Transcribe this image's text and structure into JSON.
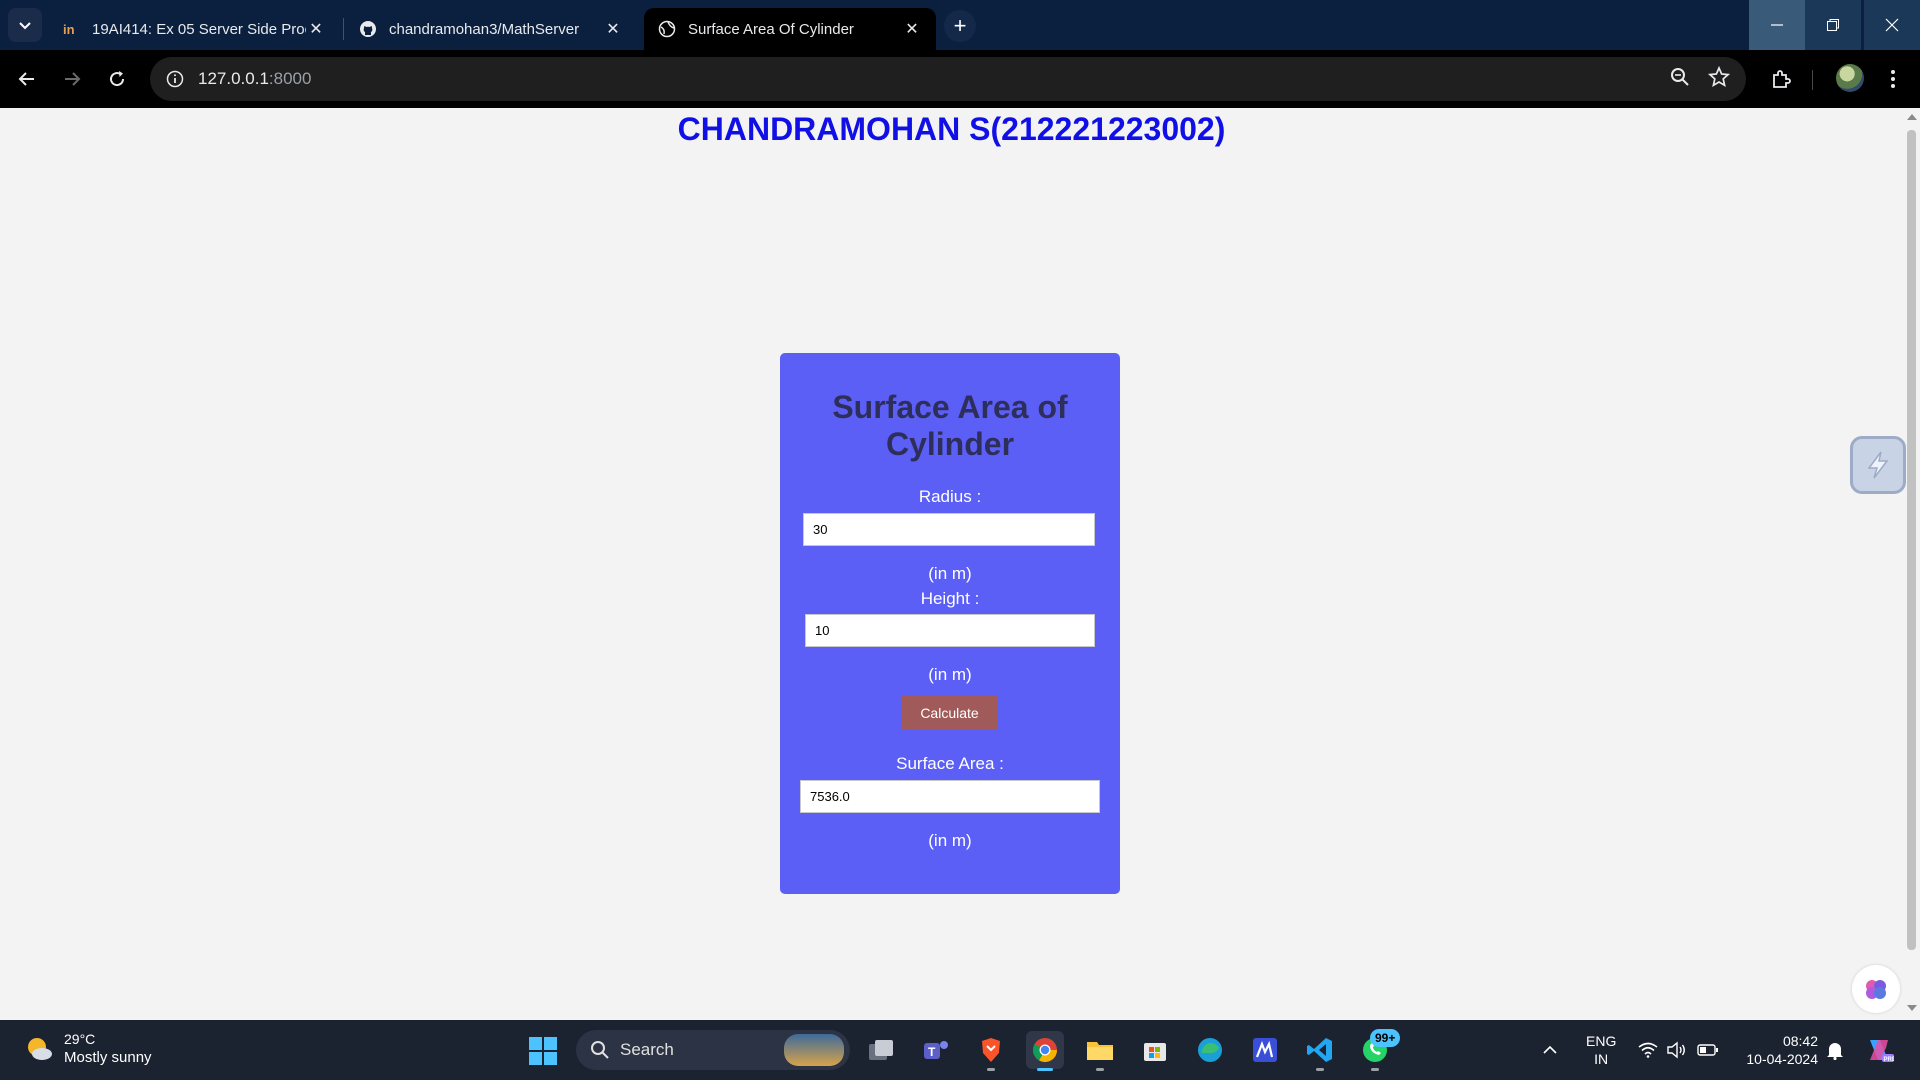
{
  "browser": {
    "tabs": [
      {
        "title": "19AI414: Ex 05 Server Side Proc",
        "active": false
      },
      {
        "title": "chandramohan3/MathServer",
        "active": false
      },
      {
        "title": "Surface Area Of Cylinder",
        "active": true
      }
    ],
    "url_host": "127.0.0.1",
    "url_port": ":8000"
  },
  "page": {
    "heading": "CHANDRAMOHAN S(212221223002)",
    "form": {
      "title": "Surface Area of Cylinder",
      "radius_label": "Radius :",
      "radius_value": "30",
      "radius_unit": "(in m)",
      "height_label": "Height :",
      "height_value": "10",
      "height_unit": "(in m)",
      "calculate_label": "Calculate",
      "area_label": "Surface Area :",
      "area_value": "7536.0",
      "area_unit": "(in m)"
    },
    "colors": {
      "heading": "#1010e6",
      "card": "#5b5ff5",
      "button": "#a05a5a"
    }
  },
  "taskbar": {
    "weather_temp": "29°C",
    "weather_condition": "Mostly sunny",
    "search_label": "Search",
    "whatsapp_badge": "99+",
    "lang_line1": "ENG",
    "lang_line2": "IN",
    "time": "08:42",
    "date": "10-04-2024"
  }
}
